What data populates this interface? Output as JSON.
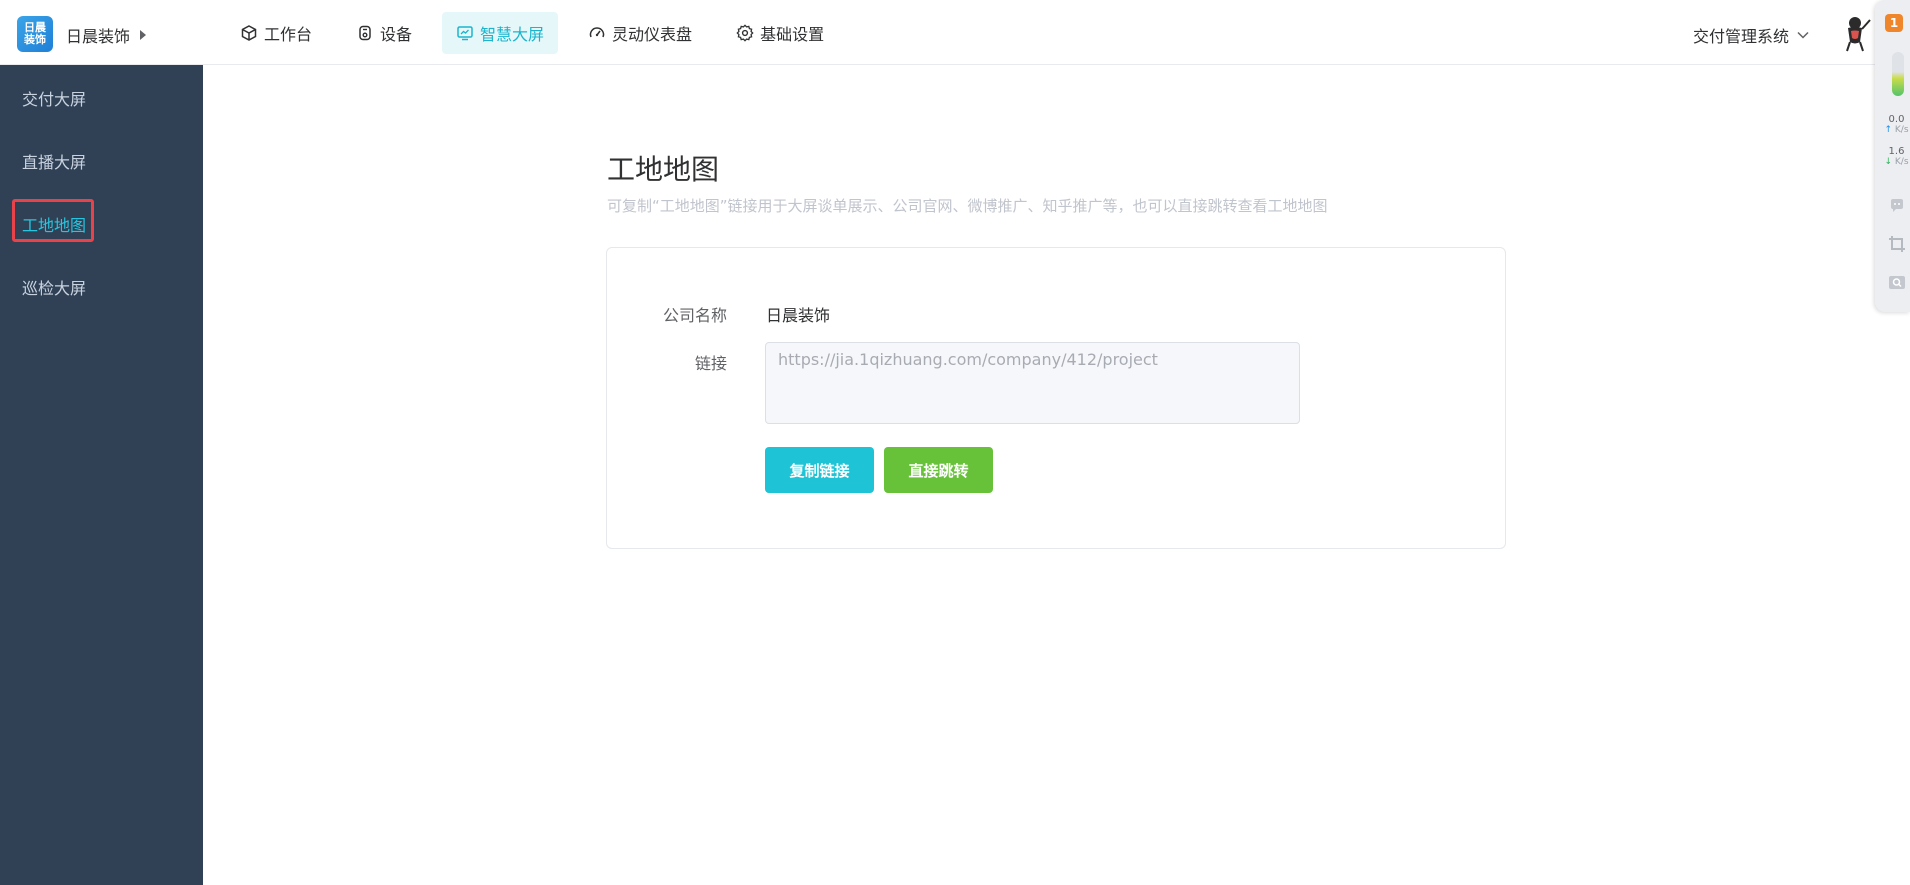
{
  "header": {
    "logo_text": "日晨\n装饰",
    "company_name": "日晨装饰",
    "nav": [
      {
        "label": "工作台",
        "icon": "cube-icon"
      },
      {
        "label": "设备",
        "icon": "device-icon"
      },
      {
        "label": "智慧大屏",
        "icon": "monitor-icon",
        "active": true
      },
      {
        "label": "灵动仪表盘",
        "icon": "dashboard-icon"
      },
      {
        "label": "基础设置",
        "icon": "gear-icon"
      }
    ],
    "system_name": "交付管理系统"
  },
  "sidebar": {
    "items": [
      {
        "label": "交付大屏"
      },
      {
        "label": "直播大屏"
      },
      {
        "label": "工地地图",
        "active": true
      },
      {
        "label": "巡检大屏"
      }
    ]
  },
  "main": {
    "title": "工地地图",
    "description": "可复制“工地地图”链接用于大屏谈单展示、公司官网、微博推广、知乎推广等，也可以直接跳转查看工地地图",
    "form": {
      "company_label": "公司名称",
      "company_value": "日晨装饰",
      "link_label": "链接",
      "link_value": "https://jia.1qizhuang.com/company/412/project"
    },
    "buttons": {
      "copy": "复制链接",
      "jump": "直接跳转"
    }
  },
  "widget": {
    "badge": "1",
    "upload_speed": "0.0",
    "download_speed": "1.6",
    "speed_unit": "K/s",
    "colors": {
      "badge": "#f0862b"
    }
  },
  "colors": {
    "sidebar_bg": "#304156",
    "accent": "#1ab5cd",
    "copy_button": "#1ec3d6",
    "jump_button": "#67c23a",
    "highlight": "#e8424a"
  }
}
